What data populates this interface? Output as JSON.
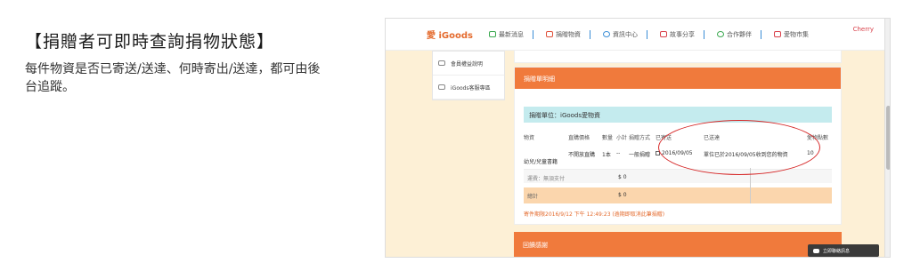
{
  "slide": {
    "title": "【捐贈者可即時查詢捐物狀態】",
    "desc": "每件物資是否已寄送/送達、何時寄出/送達，都可由後台追蹤。"
  },
  "site": {
    "logo": "愛 iGoods",
    "user": "Cherry"
  },
  "nav": [
    {
      "label": "最新消息",
      "icon": "news-icon",
      "color": "#3aa84f"
    },
    {
      "label": "捐贈物資",
      "icon": "gift-icon",
      "color": "#e0513a"
    },
    {
      "label": "資訊中心",
      "icon": "info-icon",
      "color": "#3b8ed6"
    },
    {
      "label": "故事分享",
      "icon": "book-icon",
      "color": "#d9404a"
    },
    {
      "label": "合作夥伴",
      "icon": "partner-icon",
      "color": "#3aa84f"
    },
    {
      "label": "愛物市集",
      "icon": "heart-icon",
      "color": "#d9404a"
    }
  ],
  "sidemenu": [
    {
      "label": "會員權益說明",
      "icon": "member-icon"
    },
    {
      "label": "iGoods客服專區",
      "icon": "support-icon"
    }
  ],
  "panel": {
    "heading": "捐贈單明細",
    "donor": "捐贈單位：iGoods愛物資",
    "headers": [
      "物資",
      "直購價格",
      "數量",
      "小計",
      "捐贈方式",
      "已寄送",
      "已送達",
      "愛物點數"
    ],
    "item": {
      "name": "幼兒/兒童書籍",
      "price": "不開放直購",
      "qty": "1本",
      "subtotal": "--",
      "method": "一般捐贈",
      "sent_date": "2016/09/05",
      "delivered": "單位已於2016/09/05收到您的物資",
      "points": "10"
    },
    "ship": {
      "label": "運費：無須支付",
      "amount": "$ 0"
    },
    "total": {
      "label": "總計",
      "amount": "$ 0"
    },
    "expiry": "寄件期限2016/9/12 下午 12:49:23 (逾期即取消此筆捐贈)"
  },
  "panel2": {
    "heading": "回饋感謝"
  },
  "chat": {
    "label": "立即聯絡訊息"
  }
}
